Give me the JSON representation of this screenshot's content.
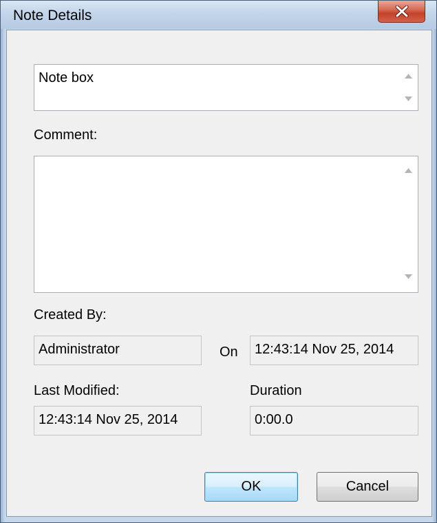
{
  "window": {
    "title": "Note Details"
  },
  "note": {
    "value": "Note box"
  },
  "comment": {
    "label": "Comment:",
    "value": ""
  },
  "created_by": {
    "label": "Created By:",
    "value": "Administrator",
    "on_label": "On",
    "on_value": "12:43:14 Nov 25, 2014"
  },
  "last_modified": {
    "label": "Last Modified:",
    "value": "12:43:14 Nov 25, 2014"
  },
  "duration": {
    "label": "Duration",
    "value": "0:00.0"
  },
  "buttons": {
    "ok": "OK",
    "cancel": "Cancel"
  },
  "icons": {
    "close": "close-icon",
    "scroll_up": "arrow-up-icon",
    "scroll_down": "arrow-down-icon"
  }
}
